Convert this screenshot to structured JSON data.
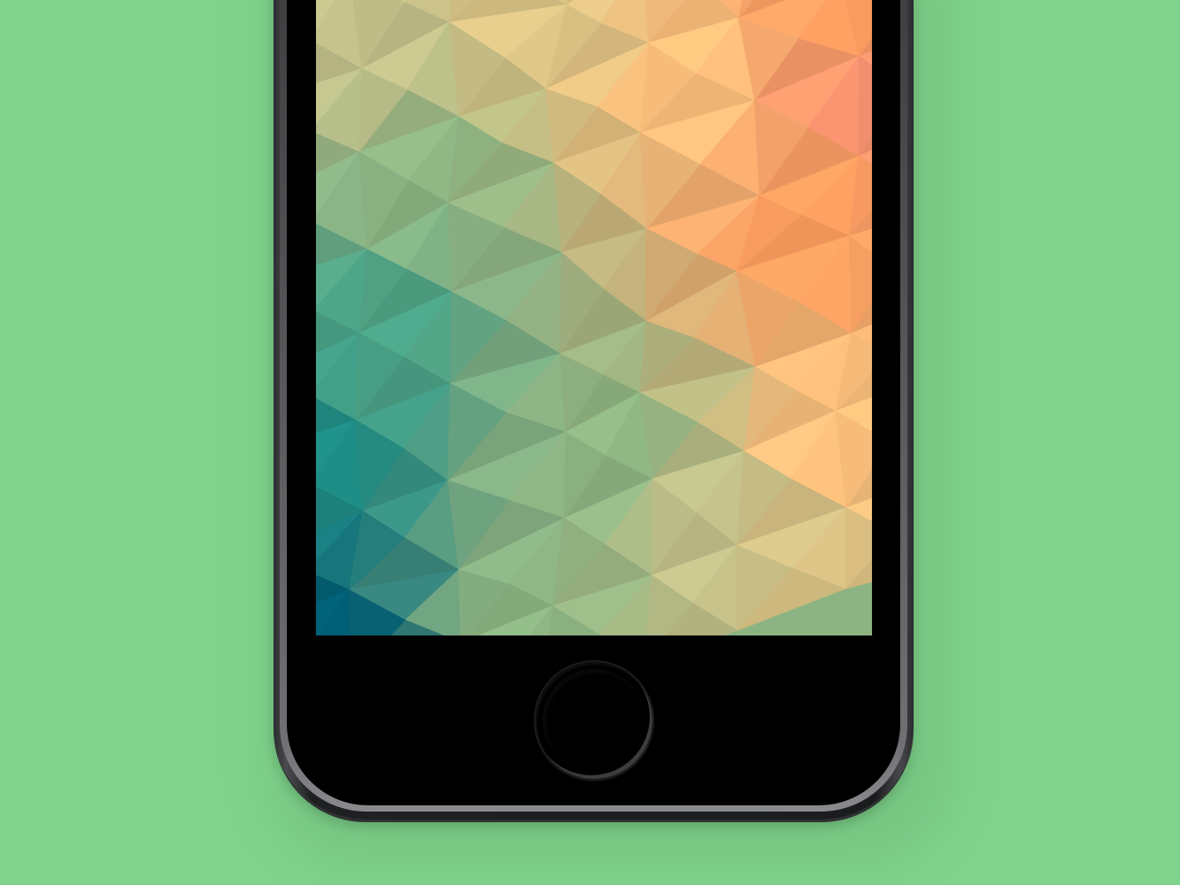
{
  "scene": {
    "background_color": "#80d38c",
    "device": "smartphone",
    "device_color": "space-gray"
  },
  "screen": {
    "content": "low-poly-gradient-wallpaper",
    "colors": {
      "deep_teal": "#005d73",
      "teal": "#1d8b84",
      "sea_green": "#4aa286",
      "sage": "#8cb482",
      "olive": "#c3c08a",
      "sand": "#dcc486",
      "peach": "#fdc07c",
      "orange": "#ff9e5f",
      "coral": "#f59070"
    }
  },
  "home_button": {
    "icon": "home-button-circle"
  }
}
